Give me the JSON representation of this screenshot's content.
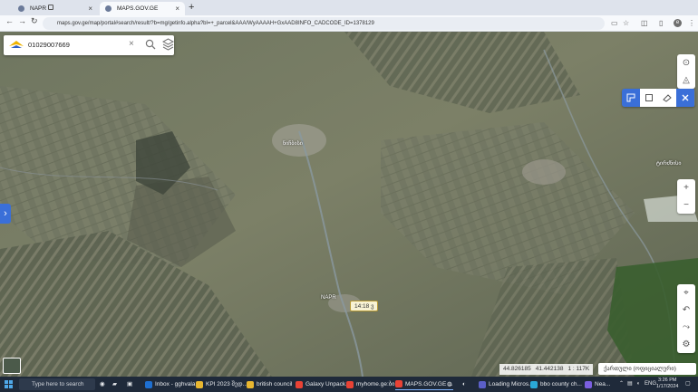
{
  "browser": {
    "tabs": [
      {
        "title": "NAPR",
        "close": "×"
      },
      {
        "title": "MAPS.GOV.GE",
        "close": "×"
      }
    ],
    "new_tab": "+",
    "url": "maps.gov.ge/map/portal#search/result/?b=mg/getinfo.alpha?bl=+_parcel&AAA/WyAAAAH+GxAAD8INFO_CADCODE_ID=1378129",
    "profile_initial": "e"
  },
  "map": {
    "search_value": "01029007669",
    "place_label": "ნიჩბისი",
    "place_label_2": "ტირძნისი",
    "town_label": "NAPR",
    "route_badge": "14:18 ვ",
    "zoom_in": "+",
    "zoom_out": "−",
    "coordinates": {
      "lat": "44.826185",
      "lon": "41.442138",
      "scale": "1 : 117K"
    },
    "language_select": "ქართული (ოფიციალური)"
  },
  "taskbar": {
    "search_placeholder": "Type here to search",
    "items": [
      {
        "label": "Inbox - gghvala...",
        "color": "#1e6fd1"
      },
      {
        "label": "KPI 2023 შედ...",
        "color": "#e8b630"
      },
      {
        "label": "british council",
        "color": "#e8b630"
      },
      {
        "label": "Galaxy Unpack...",
        "color": "#e94235"
      },
      {
        "label": "myhome.ge:ბი...",
        "color": "#e94235"
      },
      {
        "label": "MAPS.GOV.GE ...",
        "color": "#e94235"
      },
      {
        "label": "Loading Micros...",
        "color": "#5b5fc7"
      },
      {
        "label": "bbo county ch...",
        "color": "#2aa8d8"
      },
      {
        "label": "Nea...",
        "color": "#7b5fe0"
      }
    ],
    "tray_lang": "ENG",
    "time": "3:26 PM",
    "date": "1/17/2024"
  }
}
